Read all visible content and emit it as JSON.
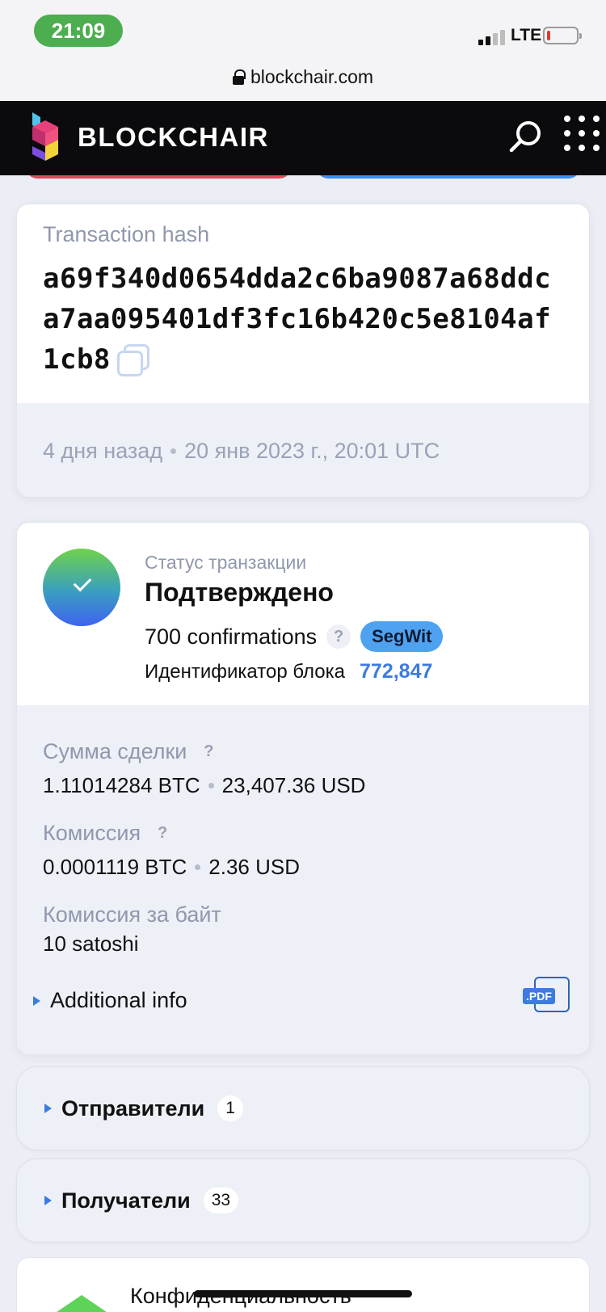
{
  "status_bar": {
    "time": "21:09",
    "network": "LTE"
  },
  "browser": {
    "url": "blockchair.com"
  },
  "header": {
    "brand": "BLOCKCHAIR"
  },
  "transaction": {
    "hash_label": "Transaction hash",
    "hash": "a69f340d0654dda2c6ba9087a68ddca7aa095401df3fc16b420c5e8104af1cb8",
    "relative_time": "4 дня назад",
    "datetime": "20 янв 2023 г., 20:01 UTC"
  },
  "status": {
    "label": "Статус транзакции",
    "value": "Подтверждено",
    "confirmations": "700 confirmations",
    "help": "?",
    "badge": "SegWit",
    "block_label": "Идентификатор блока",
    "block_id": "772,847"
  },
  "details": {
    "amount": {
      "label": "Сумма сделки",
      "btc": "1.11014284 BTC",
      "usd": "23,407.36 USD"
    },
    "fee": {
      "label": "Комиссия",
      "btc": "0.0001119 BTC",
      "usd": "2.36 USD"
    },
    "fee_per_byte": {
      "label": "Комиссия за байт",
      "value": "10 satoshi"
    },
    "additional_info": "Additional info",
    "pdf": ".PDF"
  },
  "sections": [
    {
      "title": "Отправители",
      "count": "1"
    },
    {
      "title": "Получатели",
      "count": "33"
    }
  ],
  "privacy": {
    "title": "Конфиденциальность"
  },
  "colors": {
    "accent": "#3d7be0",
    "navbar": "#0b0b0d",
    "status_pill": "#4cae4f",
    "segwit": "#4fa2f0"
  }
}
